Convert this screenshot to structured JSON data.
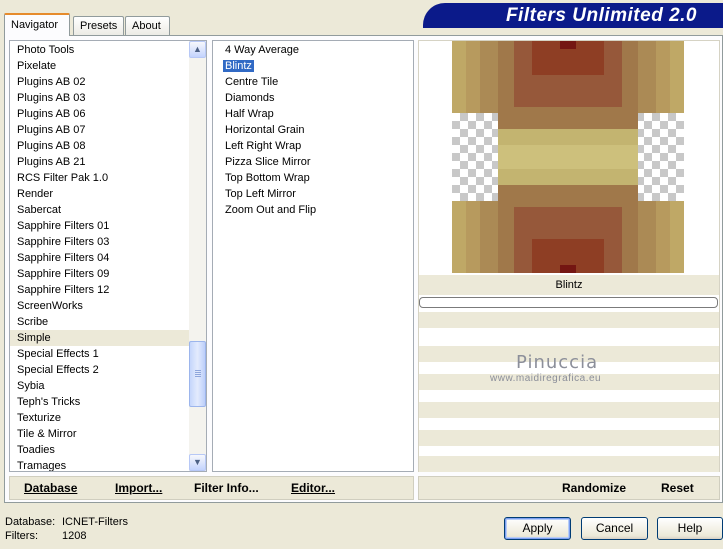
{
  "tabs": [
    "Navigator",
    "Presets",
    "About"
  ],
  "banner_title": "Filters Unlimited 2.0",
  "categories": [
    "Photo Tools",
    "Pixelate",
    "Plugins AB 02",
    "Plugins AB 03",
    "Plugins AB 06",
    "Plugins AB 07",
    "Plugins AB 08",
    "Plugins AB 21",
    "RCS Filter Pak 1.0",
    "Render",
    "Sabercat",
    "Sapphire Filters 01",
    "Sapphire Filters 03",
    "Sapphire Filters 04",
    "Sapphire Filters 09",
    "Sapphire Filters 12",
    "ScreenWorks",
    "Scribe",
    "Simple",
    "Special Effects 1",
    "Special Effects 2",
    "Sybia",
    "Teph's Tricks",
    "Texturize",
    "Tile & Mirror",
    "Toadies",
    "Tramages"
  ],
  "selected_category": "Simple",
  "filters": [
    "4 Way Average",
    "Blintz",
    "Centre Tile",
    "Diamonds",
    "Half Wrap",
    "Horizontal Grain",
    "Left Right Wrap",
    "Pizza Slice Mirror",
    "Top Bottom Wrap",
    "Top Left Mirror",
    "Zoom Out and Flip"
  ],
  "selected_filter": "Blintz",
  "preview_filter_name": "Blintz",
  "progress": 0,
  "watermark": {
    "line1": "Pinuccia",
    "line2": "www.maidiregrafica.eu"
  },
  "actions_left": {
    "database": "Database",
    "import": "Import...",
    "filter_info": "Filter Info...",
    "editor": "Editor..."
  },
  "actions_right": {
    "randomize": "Randomize",
    "reset": "Reset"
  },
  "status": {
    "database_label": "Database:",
    "database_value": "ICNET-Filters",
    "filters_label": "Filters:",
    "filters_value": "1208"
  },
  "buttons": {
    "apply": "Apply",
    "cancel": "Cancel",
    "help": "Help"
  },
  "colors": {
    "banner_bg": "#0b1a8a",
    "selection": "#316ac5",
    "dialog_bg": "#ece9d8",
    "tab_accent": "#e68b2c"
  },
  "icons": {
    "scroll_up": "▲",
    "scroll_down": "▼"
  }
}
